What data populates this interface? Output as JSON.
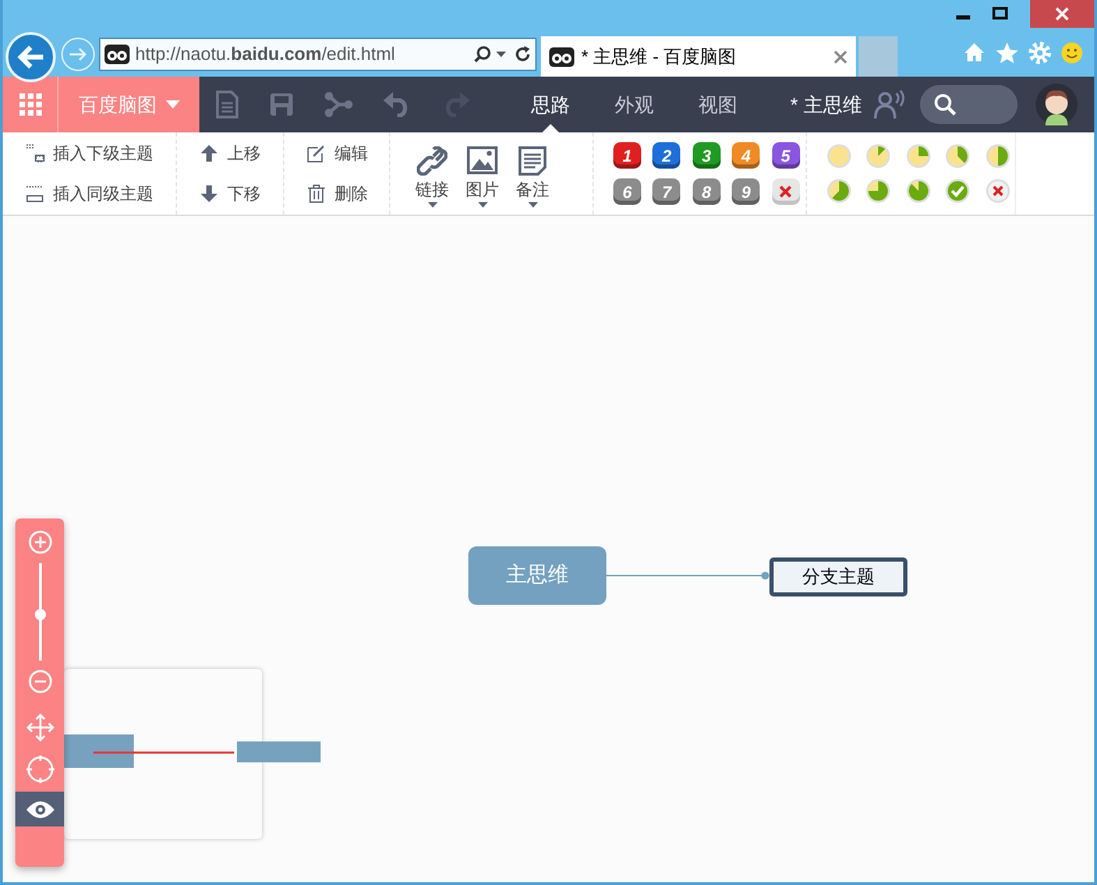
{
  "browser": {
    "url": "http://naotu.**baidu.com**/edit.html",
    "tabs": [
      {
        "title": "* 主思维 - 百度脑图",
        "selected": true
      },
      {
        "selected": false
      }
    ]
  },
  "app": {
    "brand": "百度脑图",
    "nav": [
      {
        "label": "思路",
        "selected": true
      },
      {
        "label": "外观",
        "selected": false
      },
      {
        "label": "视图",
        "selected": false
      }
    ],
    "doc_title": "* 主思维"
  },
  "toolbar": {
    "insert": [
      "插入下级主题",
      "插入同级主题"
    ],
    "move": [
      "上移",
      "下移"
    ],
    "edit": [
      "编辑",
      "删除"
    ],
    "attach": [
      "链接",
      "图片",
      "备注"
    ],
    "priority": [
      {
        "kind": "number",
        "label": "1",
        "color": "#e02020"
      },
      {
        "kind": "number",
        "label": "2",
        "color": "#1e6fd9"
      },
      {
        "kind": "number",
        "label": "3",
        "color": "#1f9a22"
      },
      {
        "kind": "number",
        "label": "4",
        "color": "#f08a24"
      },
      {
        "kind": "number",
        "label": "5",
        "color": "#8a55e0"
      },
      {
        "kind": "number",
        "label": "6",
        "color": "#8c8c8c"
      },
      {
        "kind": "number",
        "label": "7",
        "color": "#8c8c8c"
      },
      {
        "kind": "number",
        "label": "8",
        "color": "#8c8c8c"
      },
      {
        "kind": "number",
        "label": "9",
        "color": "#8c8c8c"
      },
      {
        "kind": "clear"
      }
    ],
    "progress": [
      {
        "kind": "empty"
      },
      {
        "kind": "eighth"
      },
      {
        "kind": "quarter"
      },
      {
        "kind": "threeeighths"
      },
      {
        "kind": "half"
      },
      {
        "kind": "fiveeighths"
      },
      {
        "kind": "threequarters"
      },
      {
        "kind": "seveneighths"
      },
      {
        "kind": "done"
      },
      {
        "kind": "clear"
      }
    ]
  },
  "mindmap": {
    "root": "主思维",
    "children": [
      "分支主题"
    ]
  },
  "zoom": {
    "level": 0.47,
    "eye_selected": true
  }
}
